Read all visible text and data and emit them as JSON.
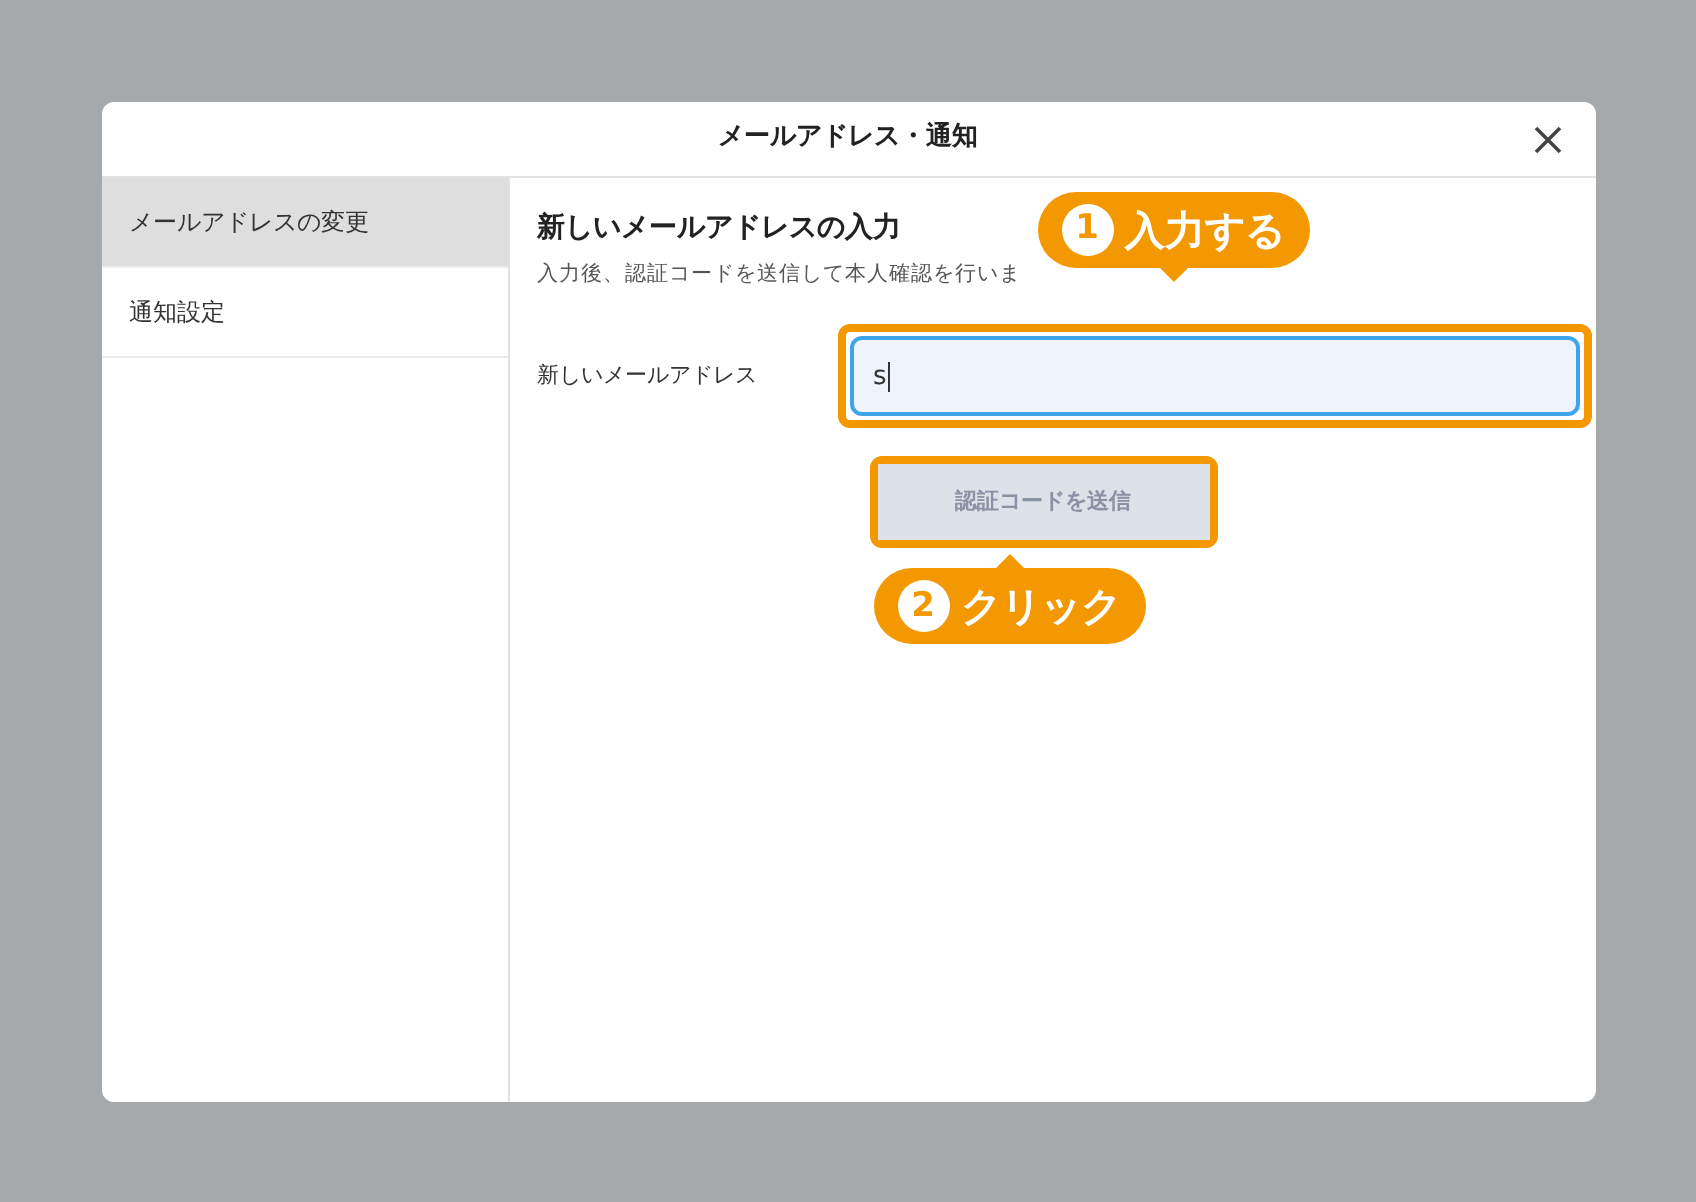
{
  "window": {
    "title": "メールアドレス・通知"
  },
  "sidebar": {
    "items": [
      {
        "label": "メールアドレスの変更",
        "selected": true
      },
      {
        "label": "通知設定",
        "selected": false
      }
    ]
  },
  "section": {
    "title": "新しいメールアドレスの入力",
    "description": "入力後、認証コードを送信して本人確認を行いま"
  },
  "email_field": {
    "label": "新しいメールアドレス",
    "value": "s",
    "focused": true
  },
  "send_button": {
    "label": "認証コードを送信",
    "disabled": true
  },
  "callouts": [
    {
      "number": "1",
      "text": "入力する"
    },
    {
      "number": "2",
      "text": "クリック"
    }
  ]
}
